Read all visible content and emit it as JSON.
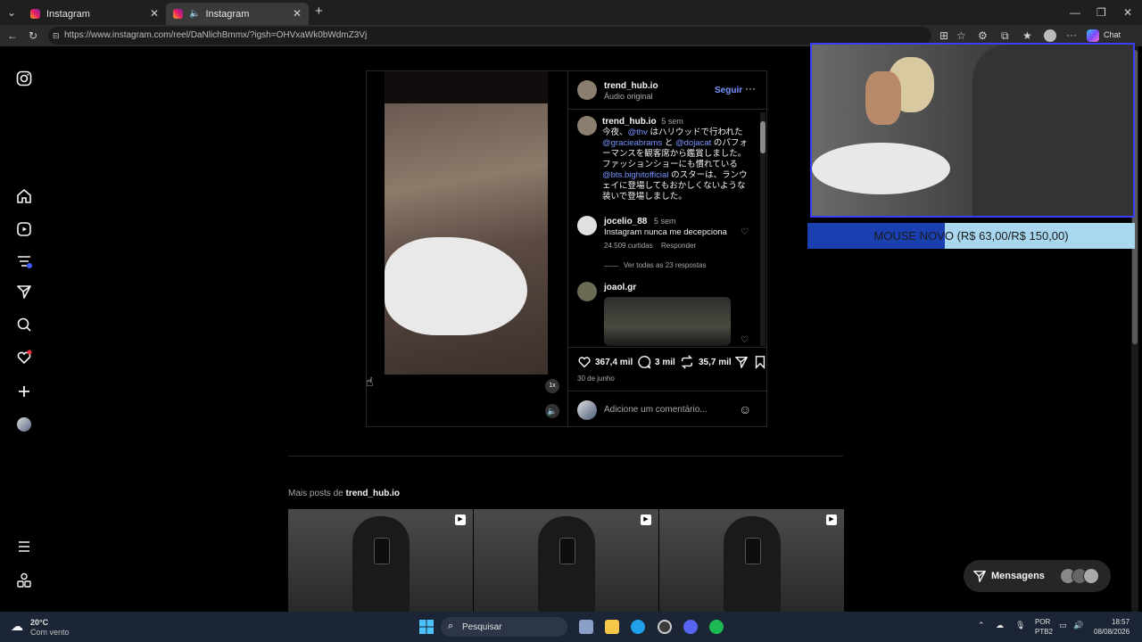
{
  "browser": {
    "tabs": [
      {
        "label": "Instagram",
        "active": false
      },
      {
        "label": "Instagram",
        "active": true
      }
    ],
    "url": "https://www.instagram.com/reel/DaNlichBmmx/?igsh=OHVxaWk0bWdmZ3Vj",
    "chat_label": "Chat"
  },
  "post": {
    "author": "trend_hub.io",
    "audio": "Áudio original",
    "follow_label": "Seguir",
    "caption_time": "5 sem",
    "caption_parts": [
      {
        "text": "今夜、",
        "link": false
      },
      {
        "text": "@thv",
        "link": true
      },
      {
        "text": " はハリウッドで行われた ",
        "link": false
      },
      {
        "text": "@gracieabrams",
        "link": true
      },
      {
        "text": " と ",
        "link": false
      },
      {
        "text": "@dojacat",
        "link": true
      },
      {
        "text": " のパフォーマンスを観客席から鑑賞しました。ファッションショーにも慣れている ",
        "link": false
      },
      {
        "text": "@bts.bighitofficial",
        "link": true
      },
      {
        "text": " のスターは、ランウェイに登場してもおかしくないような装いで登場しました。",
        "link": false
      }
    ],
    "comment1": {
      "user": "jocelio_88",
      "time": "5 sem",
      "text": "Instagram nunca me decepciona",
      "likes": "24.509 curtidas",
      "reply": "Responder",
      "view_replies": "Ver todas as 23 respostas"
    },
    "comment2": {
      "user": "joaol.gr"
    },
    "likes": "367,4 mil",
    "comments": "3 mil",
    "reposts": "35,7 mil",
    "date": "30 de junho",
    "comment_placeholder": "Adicione um comentário...",
    "speed": "1x"
  },
  "more_posts": {
    "prefix": "Mais posts de",
    "user": "trend_hub.io"
  },
  "messages_label": "Mensagens",
  "overlay_banner": {
    "text": "MOUSE NOVO (R$ 63,00/R$ 150,00)",
    "progress": 0.42
  },
  "taskbar": {
    "weather_temp": "20°C",
    "weather_desc": "Com vento",
    "search_label": "Pesquisar",
    "lang1": "POR",
    "lang2": "PTB2",
    "time": "18:57",
    "date": "08/08/2026"
  },
  "colors": {
    "accent": "#7895ff",
    "cam_border": "#3d3dff",
    "banner_bg": "#a9d7ef",
    "banner_fill": "#1a3fb0"
  }
}
